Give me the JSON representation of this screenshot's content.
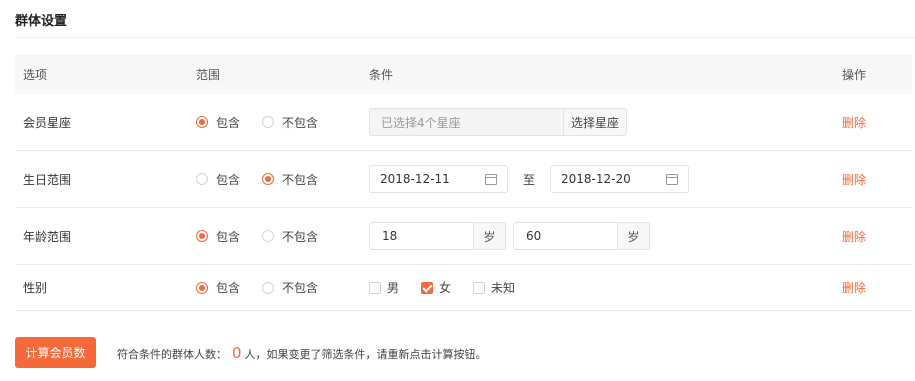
{
  "section": {
    "title": "群体设置"
  },
  "table": {
    "headers": {
      "option": "选项",
      "range": "范围",
      "condition": "条件",
      "action": "操作"
    },
    "radio_labels": {
      "include": "包含",
      "exclude": "不包含"
    },
    "delete_label": "删除",
    "rows": [
      {
        "option": "会员星座",
        "range": "include",
        "condition": {
          "placeholder": "已选择4个星座",
          "button": "选择星座"
        }
      },
      {
        "option": "生日范围",
        "range": "exclude",
        "condition": {
          "start": "2018-12-11",
          "separator": "至",
          "end": "2018-12-20"
        }
      },
      {
        "option": "年龄范围",
        "range": "include",
        "condition": {
          "min": "18",
          "max": "60",
          "unit": "岁"
        }
      },
      {
        "option": "性别",
        "range": "include",
        "condition": {
          "options": [
            {
              "label": "男",
              "checked": false
            },
            {
              "label": "女",
              "checked": true
            },
            {
              "label": "未知",
              "checked": false
            }
          ]
        }
      }
    ]
  },
  "footer": {
    "button": "计算会员数",
    "result_prefix": "符合条件的群体人数：",
    "result_count": "0",
    "result_suffix": "人，如果变更了筛选条件，请重新点击计算按钮。"
  },
  "colors": {
    "accent": "#f5693a",
    "header_bg": "#f7f7f7"
  }
}
